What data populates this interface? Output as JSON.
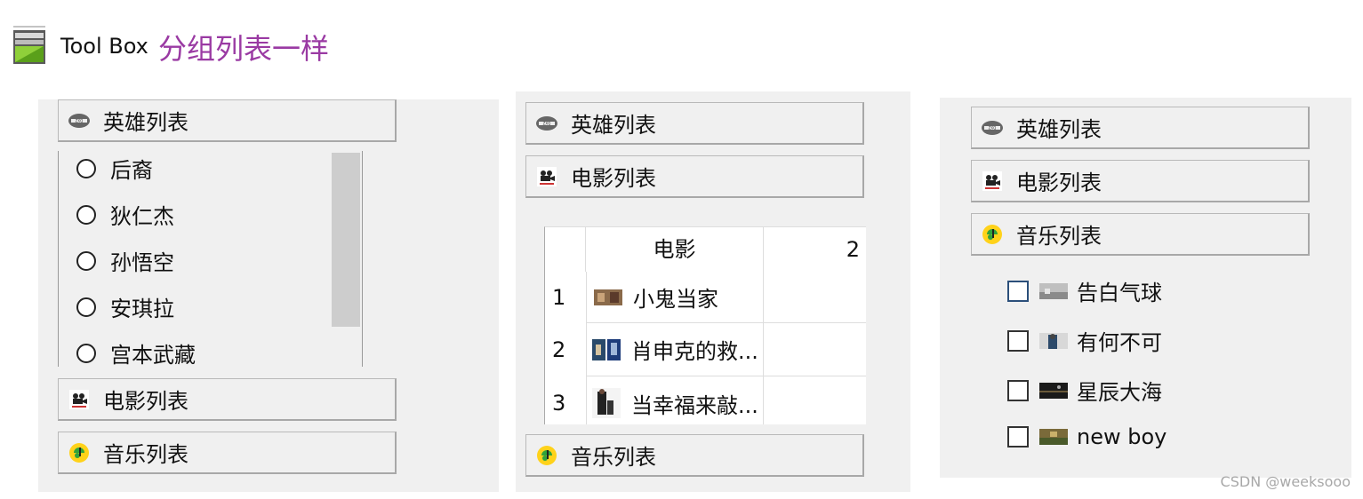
{
  "window": {
    "title_en": "Tool Box",
    "title_cn": "分组列表一样"
  },
  "panel1": {
    "sections": [
      {
        "label": "英雄列表",
        "icon": "hero-logo-icon"
      },
      {
        "label": "电影列表",
        "icon": "film-projector-icon"
      },
      {
        "label": "音乐列表",
        "icon": "music-note-icon"
      }
    ],
    "heroes": [
      "后裔",
      "狄仁杰",
      "孙悟空",
      "安琪拉",
      "宫本武藏"
    ]
  },
  "panel2": {
    "sections": [
      {
        "label": "英雄列表",
        "icon": "hero-logo-icon"
      },
      {
        "label": "电影列表",
        "icon": "film-projector-icon"
      },
      {
        "label": "音乐列表",
        "icon": "music-note-icon"
      }
    ],
    "table": {
      "headers": [
        "",
        "电影",
        "2"
      ],
      "rows": [
        {
          "index": "1",
          "title": "小鬼当家"
        },
        {
          "index": "2",
          "title": "肖申克的救..."
        },
        {
          "index": "3",
          "title": "当幸福来敲..."
        }
      ]
    }
  },
  "panel3": {
    "sections": [
      {
        "label": "英雄列表",
        "icon": "hero-logo-icon"
      },
      {
        "label": "电影列表",
        "icon": "film-projector-icon"
      },
      {
        "label": "音乐列表",
        "icon": "music-note-icon"
      }
    ],
    "songs": [
      "告白气球",
      "有何不可",
      "星辰大海",
      "new boy"
    ]
  },
  "watermark": "CSDN @weeksooo",
  "colors": {
    "title_cn": "#9a3aa3",
    "panel_bg": "#f0f0f0",
    "scroll_thumb": "#cdcdcd"
  }
}
